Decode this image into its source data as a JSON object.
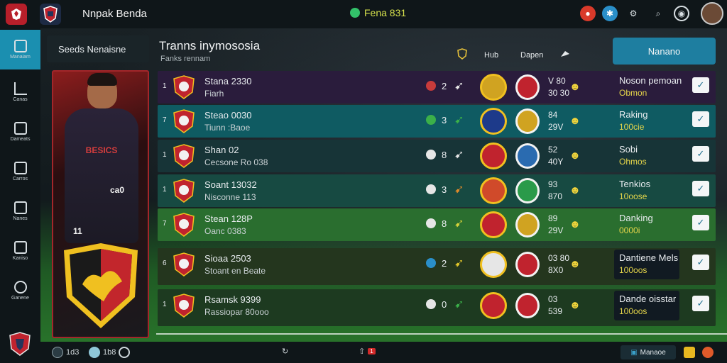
{
  "app": {
    "title": "Nnpak Benda",
    "currency_label": "Fena 831"
  },
  "topbar": {
    "icons": [
      "notification-icon",
      "info-icon",
      "settings-icon",
      "search-icon",
      "target-icon",
      "profile-avatar"
    ]
  },
  "sidebar": {
    "items": [
      {
        "label": "Manaiam",
        "icon": "squad-icon"
      },
      {
        "label": "Canas",
        "icon": "stats-icon"
      },
      {
        "label": "Dameats",
        "icon": "match-icon"
      },
      {
        "label": "Carros",
        "icon": "transfer-icon"
      },
      {
        "label": "Nanes",
        "icon": "club-icon"
      },
      {
        "label": "Kaniso",
        "icon": "training-icon"
      },
      {
        "label": "Ganene",
        "icon": "settings-icon"
      }
    ]
  },
  "squad": {
    "header": "Seeds Nenaisne",
    "card_stripe": "BESICS",
    "card_number_left": "11",
    "card_number_right": "ca0"
  },
  "ranking": {
    "title": "Tranns inymososia",
    "subtitle": "Fanks rennam",
    "header_labels": [
      "Hub",
      "Dapen"
    ],
    "action_button": "Nanano",
    "rows": [
      {
        "rank": "1",
        "name": "Stana 2330",
        "sub": "Fiarh",
        "n": "2",
        "p1": "V 80",
        "p2": "30 30",
        "stat": "Noson pemoan",
        "stat2": "Obmon",
        "row_color": "#2a1c3c"
      },
      {
        "rank": "7",
        "name": "Steao 0030",
        "sub": "Tiunn :Baoe",
        "n": "3",
        "p1": "84",
        "p2": "29V",
        "stat": "Raking",
        "stat2": "100cie",
        "row_color": "#0f5b62"
      },
      {
        "rank": "1",
        "name": "Shan 02",
        "sub": "Cecsone Ro 038",
        "n": "8",
        "p1": "52",
        "p2": "40Y",
        "stat": "Sobi",
        "stat2": "Ohmos",
        "row_color": "#173437"
      },
      {
        "rank": "1",
        "name": "Soant 13032",
        "sub": "Nisconne 113",
        "n": "3",
        "p1": "93",
        "p2": "870",
        "stat": "Tenkios",
        "stat2": "10oose",
        "row_color": "#174a42"
      },
      {
        "rank": "7",
        "name": "Stean 128P",
        "sub": "Oanc 0383",
        "n": "8",
        "p1": "89",
        "p2": "29V",
        "stat": "Danking",
        "stat2": "0000i",
        "row_color": "#2a6e2f"
      },
      {
        "rank": "6",
        "name": "Sioaa 2503",
        "sub": "Stoant en Beate",
        "n": "2",
        "p1": "03 80",
        "p2": "8X0",
        "stat": "Dantiene Mels",
        "stat2": "100oos",
        "row_color": "#24361e"
      },
      {
        "rank": "1",
        "name": "Rsamsk 9399",
        "sub": "Rassiopar 80ooo",
        "n": "0",
        "p1": "03",
        "p2": "539",
        "stat": "Dande oisstar",
        "stat2": "100oos",
        "row_color": "#1d3a20"
      }
    ]
  },
  "bottombar": {
    "items": [
      "1d3",
      "1b8"
    ],
    "center_badge": "1",
    "button_label": "Manaoe"
  }
}
